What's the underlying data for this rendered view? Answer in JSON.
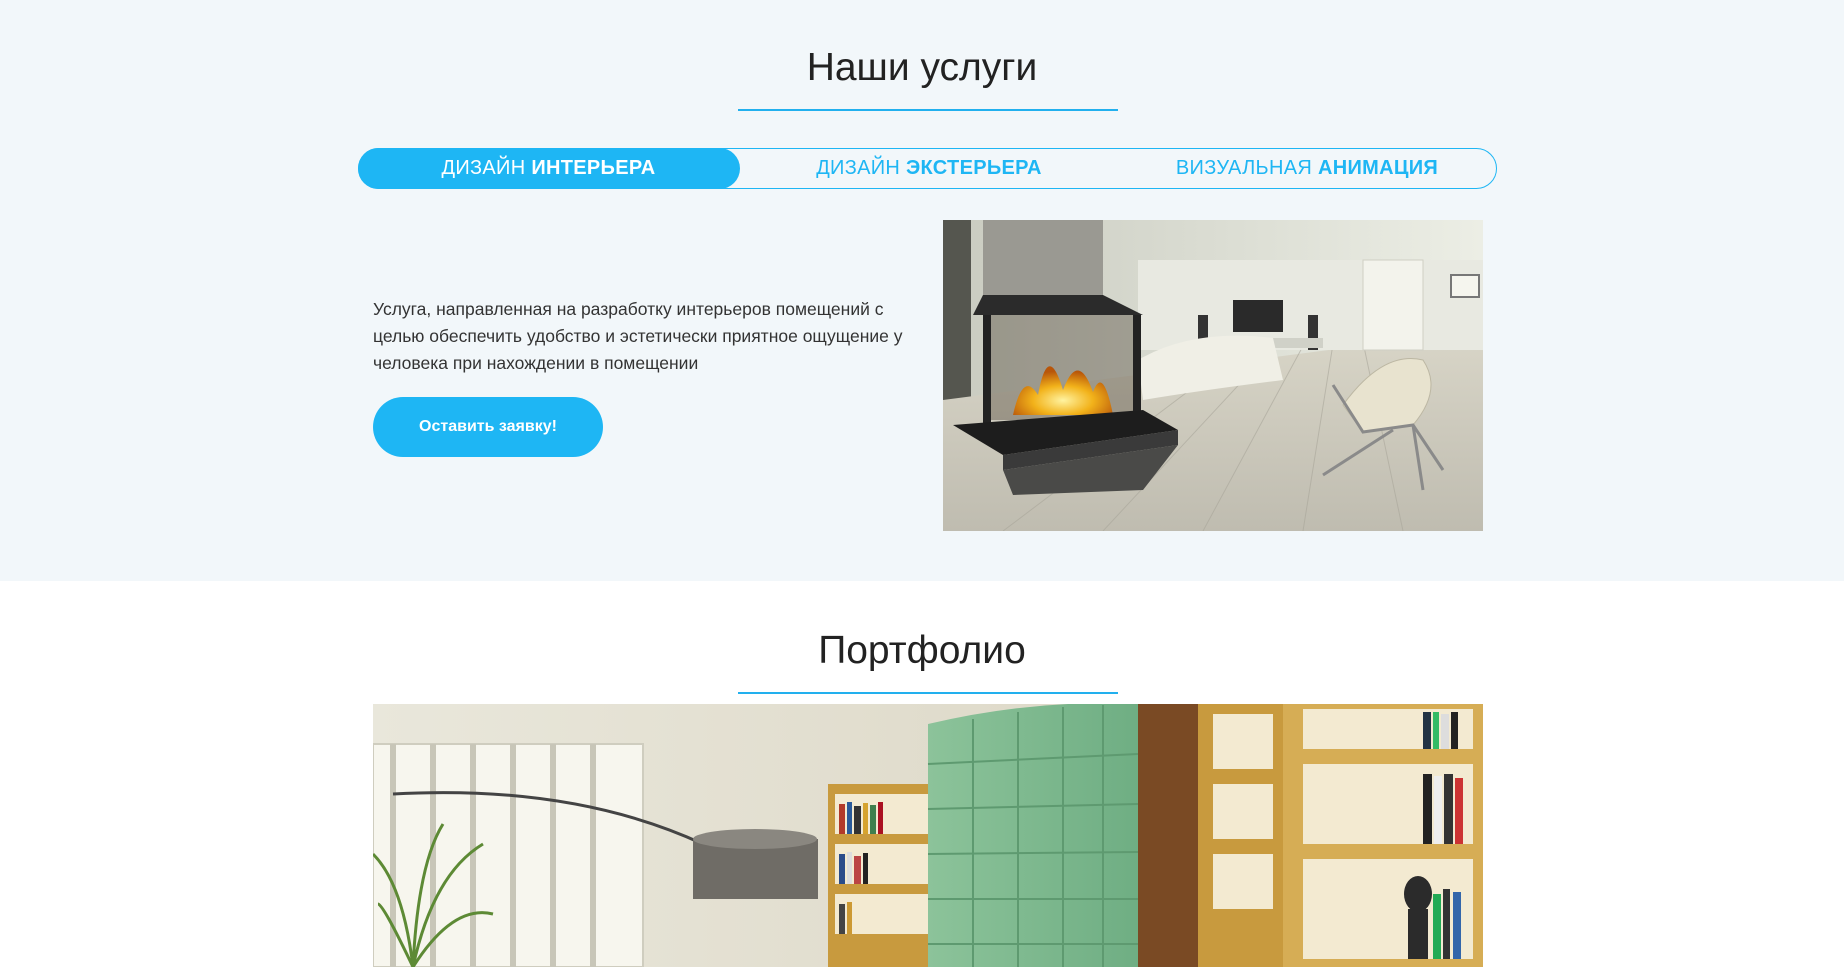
{
  "services": {
    "title": "Наши услуги",
    "tabs": [
      {
        "prefix": "ДИЗАЙН",
        "bold": "ИНТЕРЬЕРА",
        "active": true
      },
      {
        "prefix": "ДИЗАЙН",
        "bold": "ЭКСТЕРЬЕРА",
        "active": false
      },
      {
        "prefix": "ВИЗУАЛЬНАЯ",
        "bold": "АНИМАЦИЯ",
        "active": false
      }
    ],
    "description": "Услуга, направленная на разработку интерьеров помещений с целью обеспечить удобство и эстетически приятное ощущение у человека при нахождении в помещении",
    "cta_label": "Оставить заявку!"
  },
  "portfolio": {
    "title": "Портфолио"
  },
  "colors": {
    "accent": "#1eb6f4",
    "section_bg": "#f2f7fa",
    "text": "#333333"
  }
}
